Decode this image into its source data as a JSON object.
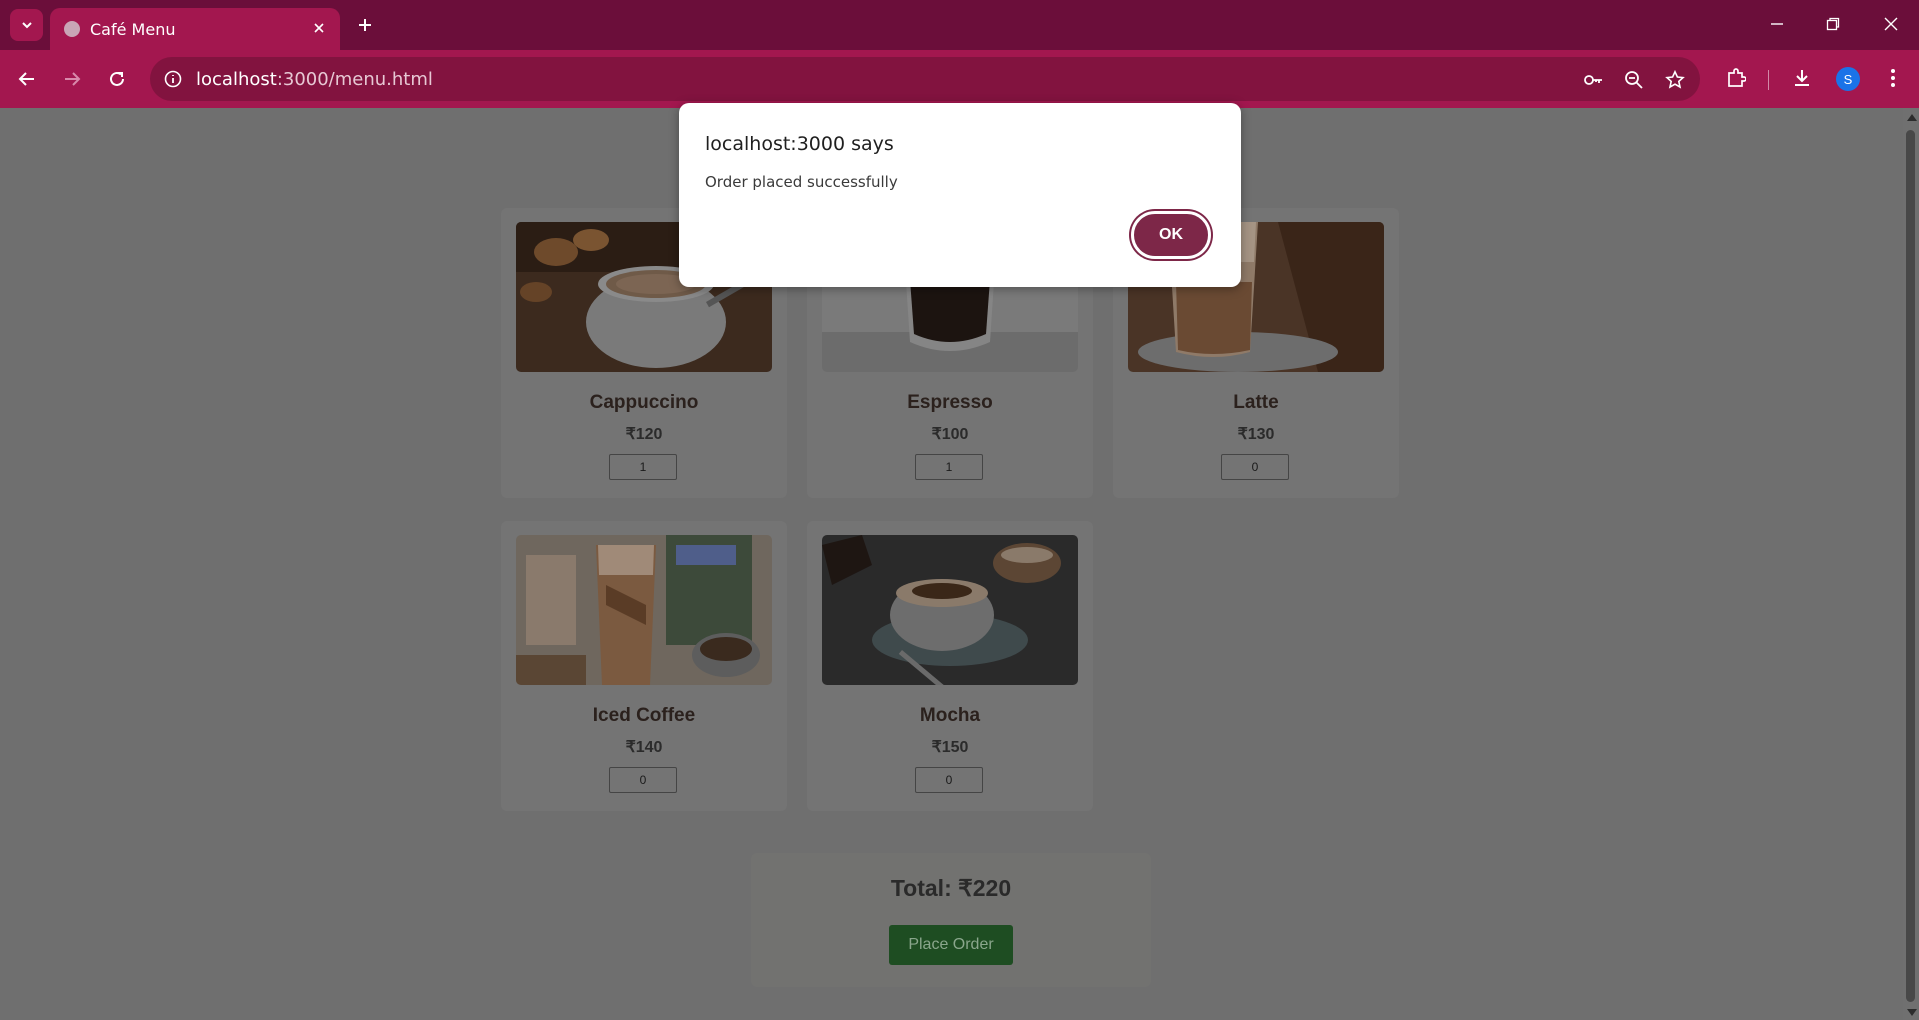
{
  "browser": {
    "tab_title": "Café Menu",
    "url_host": "localhost",
    "url_path": ":3000/menu.html",
    "avatar_letter": "S",
    "colors": {
      "frame": "#6b0e3a",
      "toolbar": "#a3174f"
    }
  },
  "menu": {
    "items": [
      {
        "name": "Cappuccino",
        "price": "₹120",
        "qty": "1"
      },
      {
        "name": "Espresso",
        "price": "₹100",
        "qty": "1"
      },
      {
        "name": "Latte",
        "price": "₹130",
        "qty": "0"
      },
      {
        "name": "Iced Coffee",
        "price": "₹140",
        "qty": "0"
      },
      {
        "name": "Mocha",
        "price": "₹150",
        "qty": "0"
      }
    ],
    "total_label": "Total: ₹220",
    "place_order_label": "Place Order"
  },
  "dialog": {
    "title": "localhost:3000 says",
    "message": "Order placed successfully",
    "ok_label": "OK"
  }
}
